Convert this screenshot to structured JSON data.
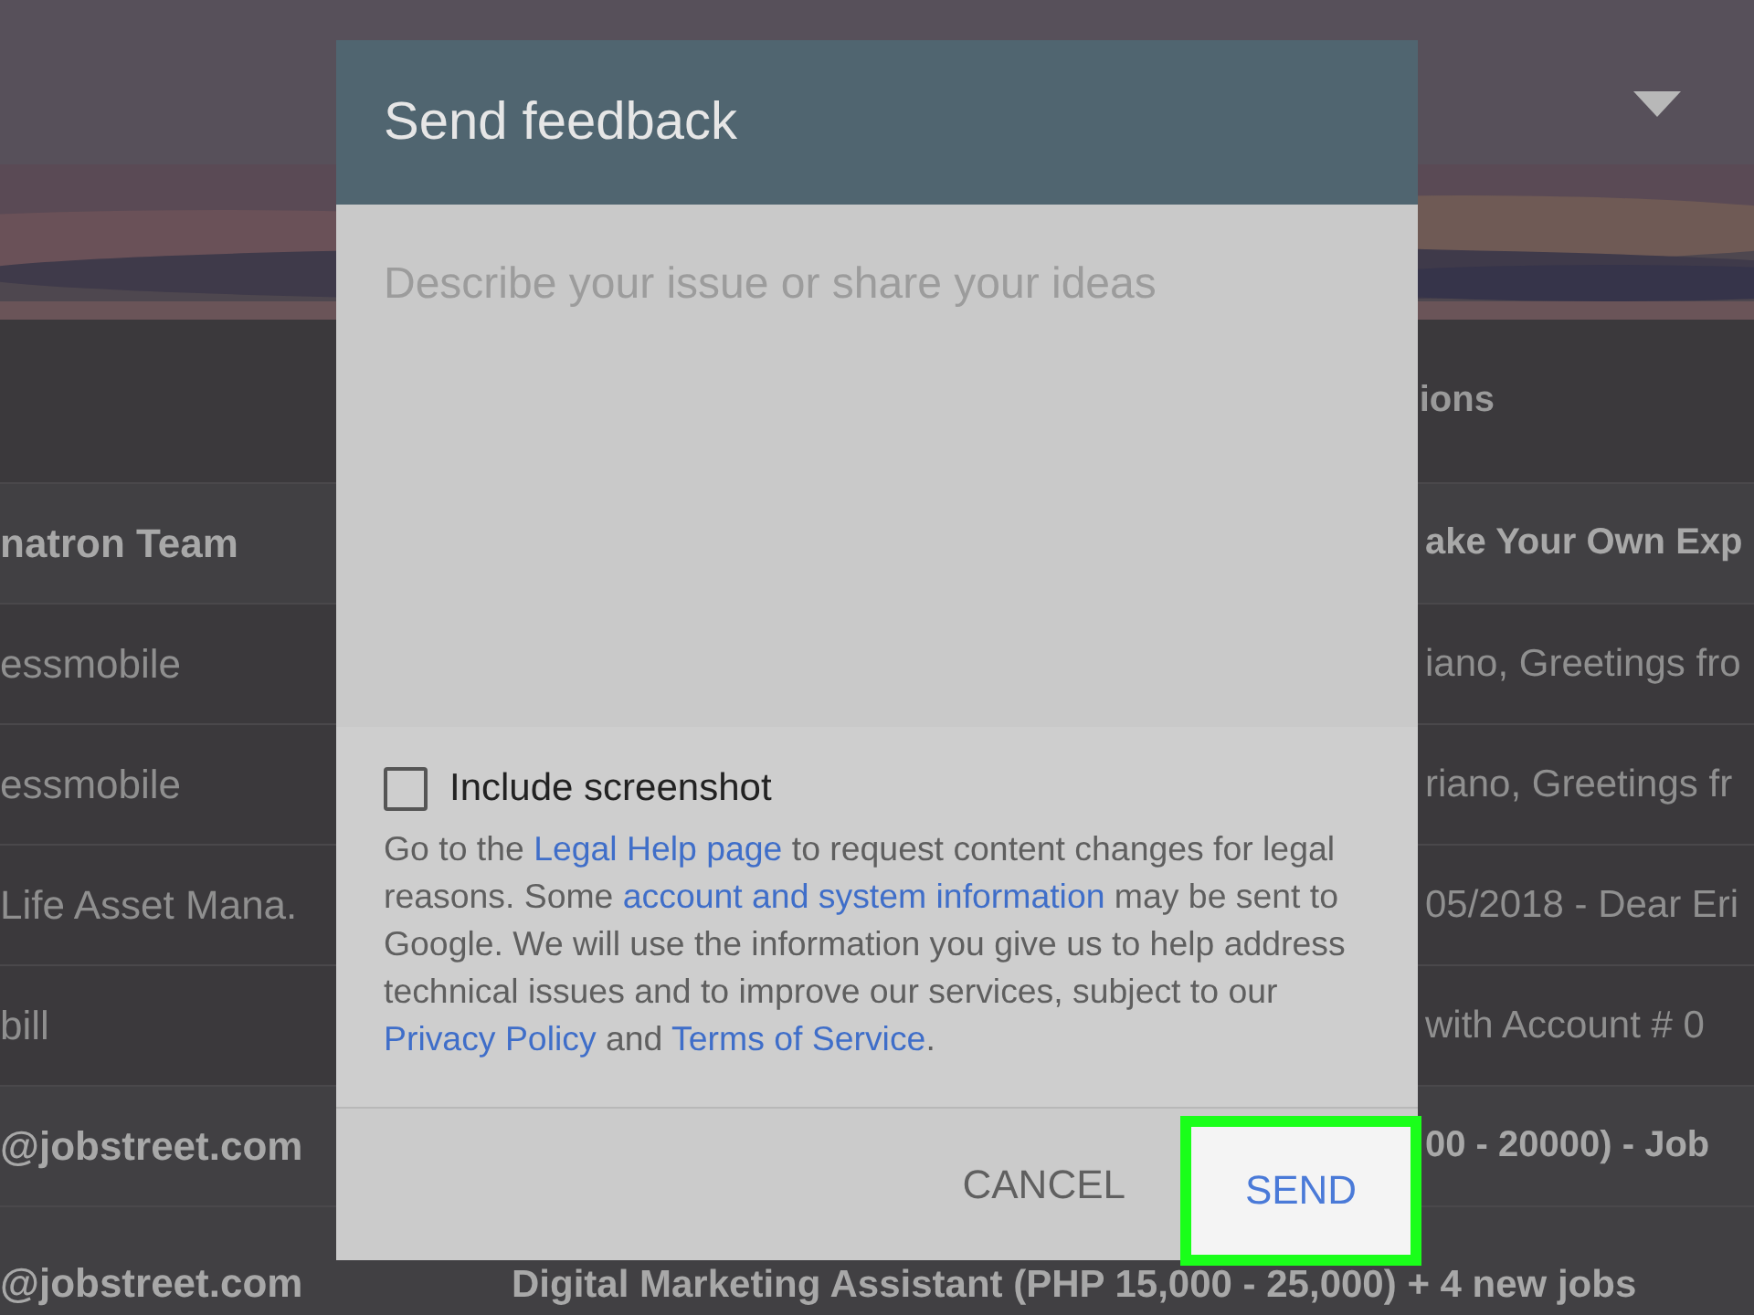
{
  "inbox": {
    "column_heading": "ions",
    "rows": [
      {
        "sender": "natron Team",
        "subject": "ake Your Own Exp",
        "unread": true
      },
      {
        "sender": "essmobile",
        "subject": "iano, Greetings fro",
        "unread": false
      },
      {
        "sender": "essmobile",
        "subject": "riano, Greetings fr",
        "unread": false
      },
      {
        "sender": "Life Asset Mana.",
        "subject": "05/2018 - Dear Eri",
        "unread": false
      },
      {
        "sender": "bill",
        "subject": "with Account # 0",
        "unread": false
      },
      {
        "sender": "@jobstreet.com",
        "subject": "00 - 20000) - Job",
        "unread": true
      }
    ],
    "last_row": {
      "sender": "@jobstreet.com",
      "subject": "Digital Marketing Assistant (PHP 15,000 - 25,000) + 4 new jobs",
      "unread": true
    }
  },
  "dialog": {
    "title": "Send feedback",
    "placeholder": "Describe your issue or share your ideas",
    "screenshot_option": {
      "label": "Include screenshot",
      "checked": false
    },
    "legal": [
      {
        "kind": "text",
        "text": "Go to the "
      },
      {
        "kind": "link",
        "text": "Legal Help page"
      },
      {
        "kind": "text",
        "text": " to request content changes for legal reasons. Some "
      },
      {
        "kind": "link",
        "text": "account and system information"
      },
      {
        "kind": "text",
        "text": " may be sent to Google. We will use the information you give us to help address technical issues and to improve our services, subject to our "
      },
      {
        "kind": "link",
        "text": "Privacy Policy"
      },
      {
        "kind": "text",
        "text": " and "
      },
      {
        "kind": "link",
        "text": "Terms of Service"
      },
      {
        "kind": "text",
        "text": "."
      }
    ],
    "buttons": [
      {
        "label": "CANCEL",
        "kind": "plain",
        "highlighted": false
      },
      {
        "label": "SEND",
        "kind": "primary",
        "highlighted": true
      }
    ]
  }
}
